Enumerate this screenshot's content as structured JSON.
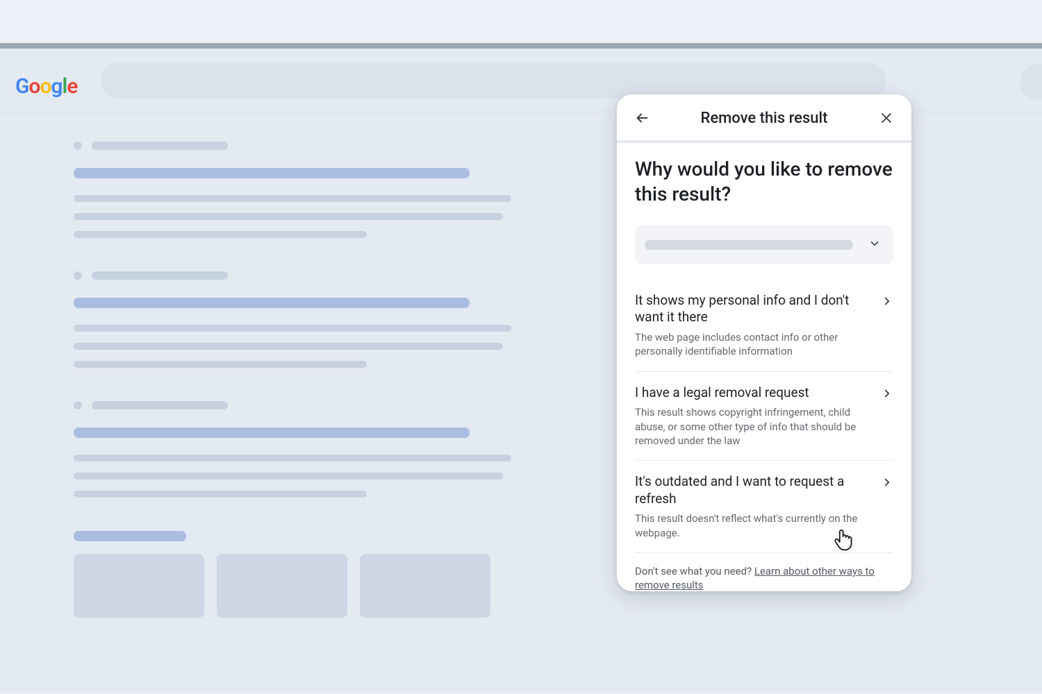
{
  "brand": {
    "name": "Google",
    "colors": [
      "#4285F4",
      "#EA4335",
      "#FBBC05",
      "#4285F4",
      "#34A853",
      "#EA4335"
    ]
  },
  "search": {
    "placeholder": ""
  },
  "panel": {
    "title": "Remove this result",
    "question": "Why would you like to remove this result?",
    "options": [
      {
        "title": "It shows my personal info and I don't want it there",
        "desc": "The web page includes contact info or other personally identifiable information"
      },
      {
        "title": "I have a legal removal request",
        "desc": "This result shows copyright infringement, child abuse, or some other type of info that should be removed under the law"
      },
      {
        "title": "It's outdated and I want to request a refresh",
        "desc": "This result doesn't reflect what's currently on the webpage."
      }
    ],
    "footer_lead": "Don't see what you need? ",
    "footer_link": "Learn about other ways to remove results"
  }
}
